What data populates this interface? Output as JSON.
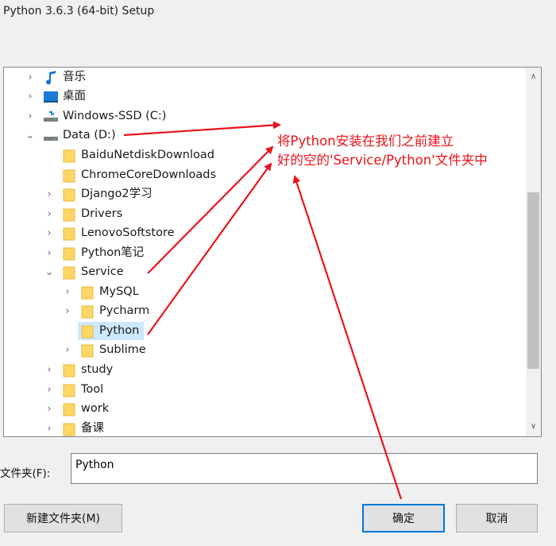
{
  "window": {
    "title": "Python 3.6.3 (64-bit) Setup"
  },
  "tree": {
    "items": [
      {
        "label": "音乐",
        "icon": "music-icon",
        "chevron": "collapsed"
      },
      {
        "label": "桌面",
        "icon": "desktop-icon",
        "chevron": "collapsed"
      },
      {
        "label": "Windows-SSD (C:)",
        "icon": "drive-icon",
        "chevron": "collapsed"
      },
      {
        "label": "Data (D:)",
        "icon": "drive-icon",
        "chevron": "expanded"
      },
      {
        "label": "BaiduNetdiskDownload",
        "icon": "folder-icon",
        "chevron": "none"
      },
      {
        "label": "ChromeCoreDownloads",
        "icon": "folder-icon",
        "chevron": "none"
      },
      {
        "label": "Django2学习",
        "icon": "folder-icon",
        "chevron": "collapsed"
      },
      {
        "label": "Drivers",
        "icon": "folder-icon",
        "chevron": "collapsed"
      },
      {
        "label": "LenovoSoftstore",
        "icon": "folder-icon",
        "chevron": "collapsed"
      },
      {
        "label": "Python笔记",
        "icon": "folder-icon",
        "chevron": "collapsed"
      },
      {
        "label": "Service",
        "icon": "folder-icon",
        "chevron": "expanded"
      },
      {
        "label": "MySQL",
        "icon": "folder-icon",
        "chevron": "collapsed"
      },
      {
        "label": "Pycharm",
        "icon": "folder-icon",
        "chevron": "collapsed"
      },
      {
        "label": "Python",
        "icon": "folder-icon",
        "chevron": "none",
        "selected": true
      },
      {
        "label": "Sublime",
        "icon": "folder-icon",
        "chevron": "collapsed"
      },
      {
        "label": "study",
        "icon": "folder-icon",
        "chevron": "collapsed"
      },
      {
        "label": "Tool",
        "icon": "folder-icon",
        "chevron": "collapsed"
      },
      {
        "label": "work",
        "icon": "folder-icon",
        "chevron": "collapsed"
      },
      {
        "label": "备课",
        "icon": "folder-icon",
        "chevron": "collapsed"
      }
    ]
  },
  "folder_field": {
    "label": "文件夹(F):",
    "value": "Python"
  },
  "buttons": {
    "new_folder": "新建文件夹(M)",
    "ok": "确定",
    "cancel": "取消"
  },
  "annotation": {
    "line1": "将Python安装在我们之前建立",
    "line2": "好的空的'Service/Python'文件夹中",
    "color": "#e8141b"
  },
  "colors": {
    "selection": "#cce8ff",
    "folder": "#ffd766",
    "primary_border": "#0078d7"
  }
}
